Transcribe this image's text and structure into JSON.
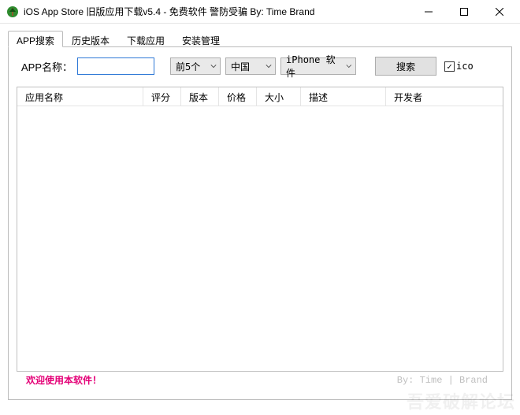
{
  "window": {
    "title": "iOS App Store 旧版应用下载v5.4 - 免费软件 警防受骗 By: Time Brand"
  },
  "tabs": [
    "APP搜索",
    "历史版本",
    "下载应用",
    "安装管理"
  ],
  "search": {
    "label": "APP名称：",
    "value": "",
    "limit": "前5个",
    "region": "中国",
    "device": "iPhone 软件",
    "button": "搜索",
    "ico_label": "ico",
    "ico_checked": true
  },
  "columns": {
    "name": "应用名称",
    "rate": "评分",
    "ver": "版本",
    "price": "价格",
    "size": "大小",
    "desc": "描述",
    "dev": "开发者"
  },
  "footer": {
    "welcome": "欢迎使用本软件！",
    "right": "By: Time | Brand"
  },
  "watermark": "吾爱破解论坛"
}
